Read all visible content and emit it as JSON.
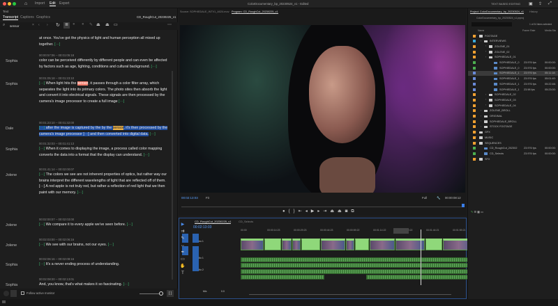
{
  "topbar": {
    "nav": [
      "Import",
      "Edit",
      "Export"
    ],
    "active": "Edit",
    "title": "ColorDocumentary_bp_20230524_v1",
    "title_status": "Edited",
    "text_based_editing": "TEXT BASED EDITING"
  },
  "text_panel": {
    "panel_title": "Text",
    "tabs": [
      "Transcript",
      "Captions",
      "Graphics"
    ],
    "active_tab": "Transcript",
    "sequence": "CD_RoughCut_20230225_v1",
    "search_value": "sensor",
    "entries": [
      {
        "speaker": "",
        "time": "",
        "pre": "at once. You've got the physics of light and human perception all mixed up together.",
        "hl": "",
        "post": "",
        "gap_end": "[···]"
      },
      {
        "speaker": "Sophia",
        "time": "00:00:57:06 – 00:01:05:18",
        "pre": "color can be perceived differently by different people and can even be affected by factors such as age, lighting, conditions and cultural background.",
        "hl": "",
        "post": "",
        "gap_end": "[···]"
      },
      {
        "speaker": "Sophia",
        "time": "00:01:05:18 – 00:01:23:10",
        "gap_start": "[···]",
        "pre": " When light hits the ",
        "hl": "sensor",
        "post": ", it passes through a color filter array, which separates the light into its primary colors. The photo sites then absorb the light and convert it into electrical signals. These signals are then processed by the camera's image processor to create a full image",
        "gap_end": "[···]"
      },
      {
        "speaker": "Dale",
        "time": "00:01:23:10 – 00:01:32:00",
        "gap_start": "[···]",
        "pre": " after the image is captured by the by the ",
        "hl": "sensor",
        "post": ", it's then processed by the camera's image processor [···] and then converted into digital data.",
        "gap_end": "[···]",
        "selected": true
      },
      {
        "speaker": "Sophia",
        "time": "00:01:32:03 – 00:01:41:13",
        "gap_start": "[···]",
        "pre": " When it comes to displaying the image, a process called color mapping converts the data into a format that the display can understand.",
        "hl": "",
        "post": "",
        "gap_end": "[···]"
      },
      {
        "speaker": "Jolene",
        "time": "00:01:41:14 – 00:02:00:07",
        "gap_start": "[···]",
        "pre": " The colors we see are not inherent properties of optics, but rather way our brains interpret the different wavelengths of light that are reflected off of them. [···] A red apple is not truly red, but rather a reflection of red light that we then paint with our memory.",
        "hl": "",
        "post": "",
        "gap_end": "[···]"
      },
      {
        "speaker": "Jolene",
        "time": "00:02:00:07 – 00:02:03:00",
        "gap_start": "[···]",
        "pre": " We compare it to every apple we've seen before.",
        "hl": "",
        "post": "",
        "gap_end": "[···]"
      },
      {
        "speaker": "Jolene",
        "time": "00:02:03:00 – 00:02:06:16",
        "gap_start": "[···]",
        "pre": " We see with our brains, not our eyes.",
        "hl": "",
        "post": "",
        "gap_end": "[···]"
      },
      {
        "speaker": "Sophia",
        "time": "00:02:06:16 – 00:02:08:16",
        "gap_start": "[···]",
        "pre": " It's a never ending process of understanding.",
        "hl": "",
        "post": "",
        "gap_end": ""
      },
      {
        "speaker": "Sophia",
        "time": "00:02:08:20 – 00:02:13:01",
        "pre": "And, you know, that's what makes it so fascinating.",
        "hl": "",
        "post": "",
        "gap_end": "[···]"
      }
    ],
    "follow_label": "Follow active monitor"
  },
  "monitor": {
    "source_tab": "Source: SOPHIEDALE_INTV1_A024.mov",
    "program_tab": "Program: CD_RoughCut_20230225_v1",
    "timecode": "00:02:13:03",
    "fit": "Fit",
    "quality": "Full",
    "duration": "00:00:08:12"
  },
  "timeline": {
    "tabs": [
      "CD_RoughCut_20230225_v1",
      "CD_Selects"
    ],
    "timecode": "00:02:13:03",
    "ruler": [
      "00:00",
      "00:00:14:23",
      "00:00:29:23",
      "00:00:44:23",
      "00:00:59:22",
      "00:01:14:22",
      "00:01:29:22",
      "00:01:44:21",
      "00:01:59:21"
    ],
    "track_labels": [
      "Video 1",
      "Audio 1",
      "Audio 2",
      "Mix"
    ],
    "mix_value": "0.0"
  },
  "project": {
    "tabs": [
      "Project: ColorDocumentary_bp_20230524_v1",
      "History"
    ],
    "bin_path": "ColorDocumentary_bp_20230524_v1.prproj",
    "items_selected": "1 of 24 items selected",
    "columns": [
      "Name",
      "Frame Rate",
      "Media Sta"
    ],
    "rows": [
      {
        "name": "FOOTAGE",
        "type": "folder",
        "indent": 0,
        "color": "#f0a030"
      },
      {
        "name": "INTERVIEWS",
        "type": "folder",
        "indent": 1,
        "color": "#3aa8d8"
      },
      {
        "name": "ZOLENE_01",
        "type": "folder",
        "indent": 2,
        "color": "#f0a030"
      },
      {
        "name": "ZOLENE_02",
        "type": "folder",
        "indent": 2,
        "color": "#f0a030"
      },
      {
        "name": "SOPHIEDALE_01",
        "type": "folder",
        "indent": 2,
        "color": "#f0a030"
      },
      {
        "name": "SOPHIEDALE_0",
        "type": "clip",
        "indent": 3,
        "color": "#4caf50",
        "fps": "23.976 fps",
        "start": "00:00:00:"
      },
      {
        "name": "SOPHIEDALE_0",
        "type": "clip",
        "indent": 3,
        "color": "#4caf50",
        "fps": "23.976 fps",
        "start": "00:00:00:"
      },
      {
        "name": "SOPHIEDALE_1",
        "type": "clip",
        "indent": 3,
        "color": "#6a8ad8",
        "fps": "23.976 fps",
        "start": "05:11:18:",
        "selected": true
      },
      {
        "name": "SOPHIEDALE_1",
        "type": "clip",
        "indent": 3,
        "color": "#6a8ad8",
        "fps": "23.976 fps",
        "start": "05:01:40:"
      },
      {
        "name": "SOPHIEDALE_1",
        "type": "clip",
        "indent": 3,
        "color": "#6a8ad8",
        "fps": "23.976 fps",
        "start": "05:22:46:"
      },
      {
        "name": "SOPHIEDALE_1",
        "type": "clip",
        "indent": 3,
        "color": "#6a8ad8",
        "fps": "23.98 fps",
        "start": "05:23:00:"
      },
      {
        "name": "SOPHIEDALE_02",
        "type": "folder",
        "indent": 2,
        "color": "#f0a030"
      },
      {
        "name": "SOPHIEDALE_03",
        "type": "folder",
        "indent": 2,
        "color": "#f0a030"
      },
      {
        "name": "SOPHIEDALE_04",
        "type": "folder",
        "indent": 2,
        "color": "#f0a030"
      },
      {
        "name": "ZOLENE_BROLL",
        "type": "folder",
        "indent": 1,
        "color": "#f0a030"
      },
      {
        "name": "ORIGINAL",
        "type": "folder",
        "indent": 1,
        "color": "#f0a030"
      },
      {
        "name": "SOPHIEDALE_BROLL",
        "type": "folder",
        "indent": 1,
        "color": "#f0a030"
      },
      {
        "name": "STOCK FOOTAGE",
        "type": "folder",
        "indent": 1,
        "color": "#f0a030"
      },
      {
        "name": "GFX",
        "type": "folder",
        "indent": 0,
        "color": "#f0a030"
      },
      {
        "name": "MUSIC",
        "type": "folder",
        "indent": 0,
        "color": "#f0a030"
      },
      {
        "name": "SEQUENCES",
        "type": "folder",
        "indent": 0,
        "color": "#f0a030"
      },
      {
        "name": "CD_RoughCut_202302",
        "type": "seq",
        "indent": 1,
        "color": "#4caf50",
        "fps": "23.976 fps",
        "start": "00:00:00:"
      },
      {
        "name": "CD_Selects",
        "type": "seq",
        "indent": 1,
        "color": "#4caf50",
        "fps": "23.976 fps",
        "start": "00:00:00:"
      },
      {
        "name": "SFX",
        "type": "folder",
        "indent": 0,
        "color": "#f0a030"
      }
    ]
  }
}
